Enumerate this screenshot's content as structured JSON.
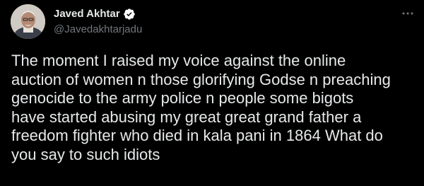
{
  "author": {
    "display_name": "Javed Akhtar",
    "handle": "@Javedakhtarjadu",
    "verified_icon": "verified-badge-icon",
    "avatar_icon": "avatar"
  },
  "menu": {
    "more_icon": "more-options-icon"
  },
  "tweet": {
    "text": "The moment I raised my voice against the online\nauction of women n those glorifying Godse n preaching\ngenocide to the army police n people  some bigots\nhave started abusing my great great grand father a\nfreedom fighter who died in kala pani in 1864 What do\nyou say to such idiots"
  },
  "colors": {
    "background": "#000000",
    "text": "#e7e9ea",
    "secondary_text": "#71767b",
    "verified": "#ffffff"
  }
}
